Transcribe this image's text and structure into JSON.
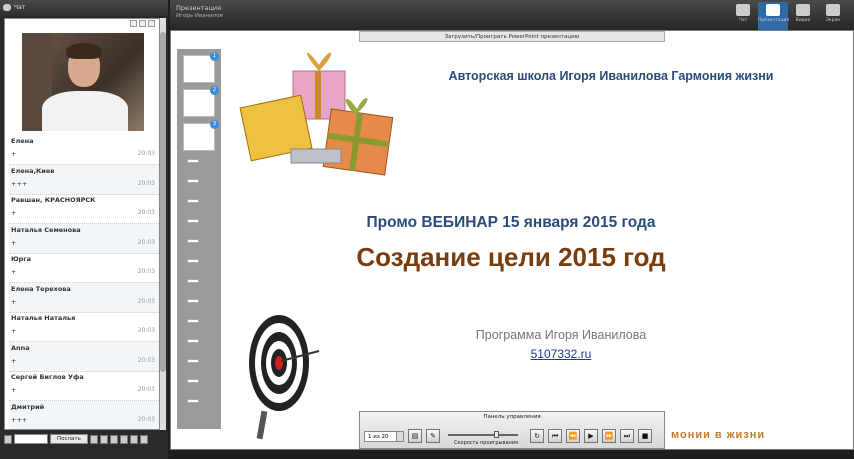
{
  "chat": {
    "header": "Чат",
    "send_label": "Послать",
    "messages": [
      {
        "name": "Елена",
        "text": "+",
        "time": "20:03"
      },
      {
        "name": "Елена,Киев",
        "text": "+++",
        "time": "20:03"
      },
      {
        "name": "Равшан, КРАСНОЯРСК",
        "text": "+",
        "time": "20:03"
      },
      {
        "name": "Наталья Семенова",
        "text": "+",
        "time": "20:03"
      },
      {
        "name": "Юрга",
        "text": "+",
        "time": "20:03"
      },
      {
        "name": "Елена Терехова",
        "text": "+",
        "time": "20:03"
      },
      {
        "name": "Наталья Наталья",
        "text": "+",
        "time": "20:03"
      },
      {
        "name": "Anna",
        "text": "+",
        "time": "20:03"
      },
      {
        "name": "Сергей Биглов   Уфа",
        "text": "+",
        "time": "20:03"
      },
      {
        "name": "Дмитрий",
        "text": "+++",
        "time": "20:03"
      }
    ]
  },
  "topbar": {
    "title": "Презентация",
    "presenter": "Игорь Иванилов",
    "buttons": [
      {
        "label": "Чат",
        "icon": "chat-icon"
      },
      {
        "label": "Презентация",
        "icon": "presentation-icon"
      },
      {
        "label": "Видео",
        "icon": "video-icon"
      },
      {
        "label": "Экран",
        "icon": "screen-icon"
      }
    ]
  },
  "presentation": {
    "load_bar": "Загрузить/Проиграть PowerPoint презентацию",
    "slide_title": "Авторская школа Игоря Иванилова Гармония жизни",
    "promo": "Промо ВЕБИНАР 15 января 2015 года",
    "goal": "Создание цели 2015 год",
    "program": "Программа Игоря Иванилова",
    "site": "5107332.ru",
    "footer": "монии в жизни",
    "thumb_badges": [
      "1",
      "2",
      "3"
    ]
  },
  "control": {
    "title": "Панель управления",
    "page": "1 из 20",
    "speed_label": "Скорость проигрывания"
  },
  "colors": {
    "accent": "#2f6aa8",
    "title": "#2c4b7a",
    "goal": "#7a3c0c",
    "footer": "#c87a2a"
  }
}
